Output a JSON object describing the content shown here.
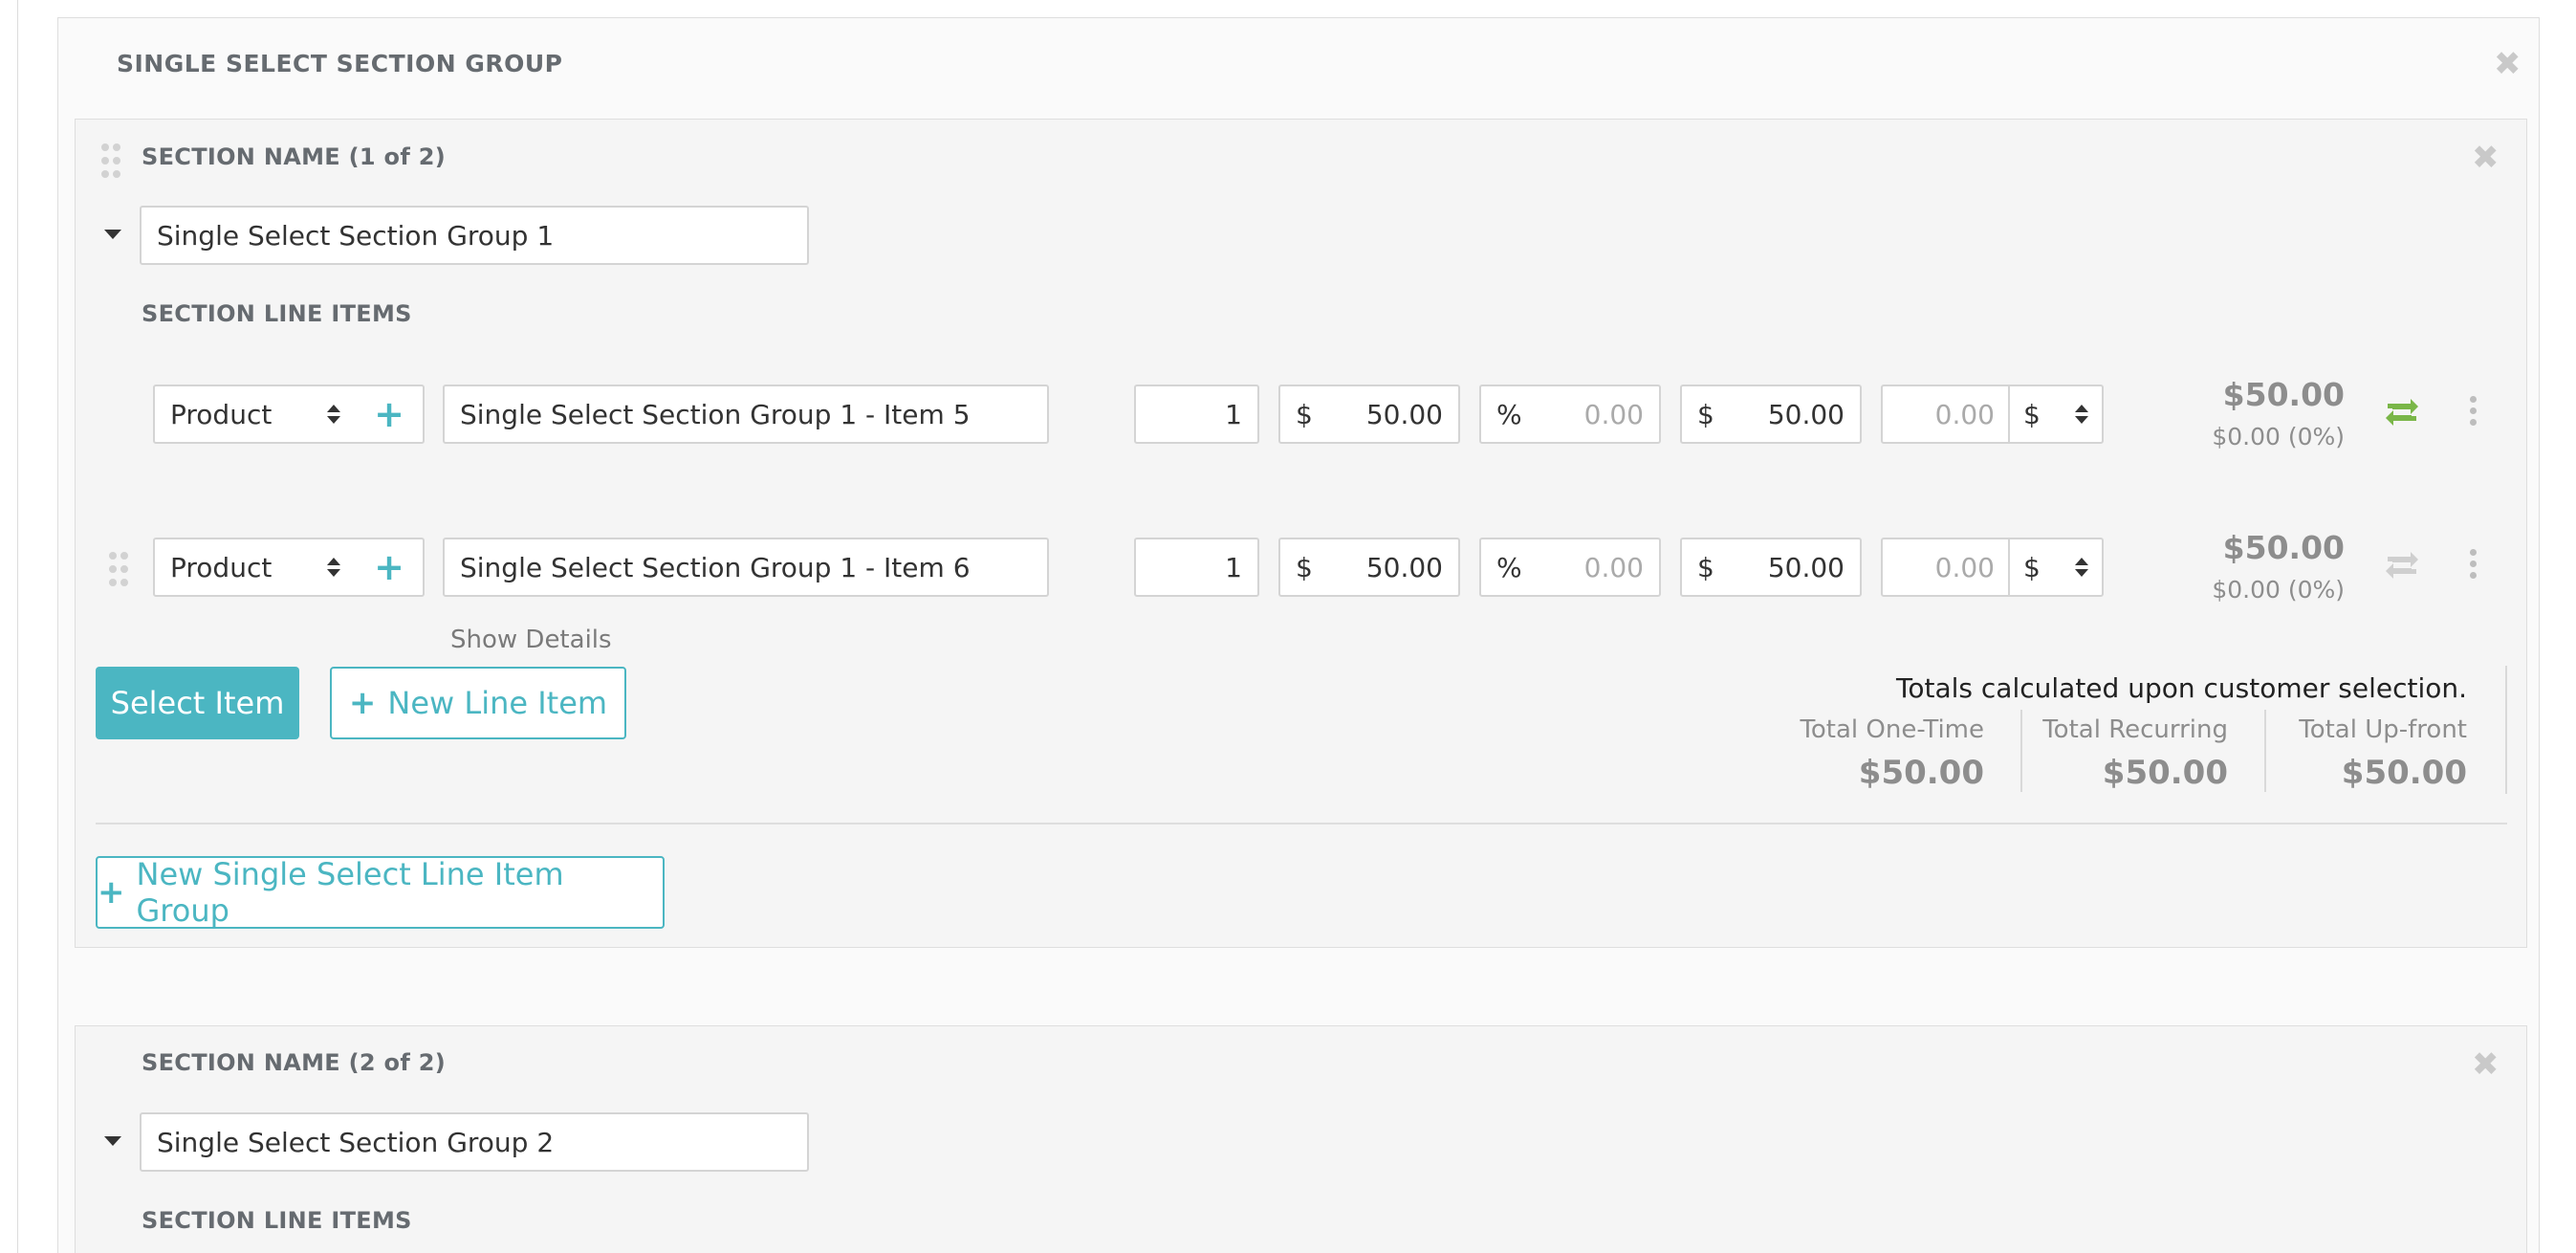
{
  "group": {
    "title": "SINGLE SELECT SECTION GROUP"
  },
  "sections": [
    {
      "title": "SECTION NAME (1 of 2)",
      "name_value": "Single Select Section Group 1",
      "line_items_title": "SECTION LINE ITEMS",
      "line_items": [
        {
          "type": "Product",
          "description": "Single Select Section Group 1 - Item 5",
          "quantity": "1",
          "currency": "$",
          "price": "50.00",
          "discount_unit": "%",
          "discount": "0.00",
          "total_currency": "$",
          "total": "50.00",
          "extra": "0.00",
          "extra_unit": "$",
          "price_main": "$50.00",
          "price_sub": "$0.00 (0%)",
          "recurring_active": true
        },
        {
          "type": "Product",
          "description": "Single Select Section Group 1 - Item 6",
          "quantity": "1",
          "currency": "$",
          "price": "50.00",
          "discount_unit": "%",
          "discount": "0.00",
          "total_currency": "$",
          "total": "50.00",
          "extra": "0.00",
          "extra_unit": "$",
          "price_main": "$50.00",
          "price_sub": "$0.00 (0%)",
          "recurring_active": false
        }
      ],
      "show_details": "Show Details",
      "select_item": "Select Item",
      "new_line_item": "New Line Item",
      "totals_note": "Totals calculated upon customer selection.",
      "totals": [
        {
          "label": "Total One-Time",
          "value": "$50.00"
        },
        {
          "label": "Total Recurring",
          "value": "$50.00"
        },
        {
          "label": "Total Up-front",
          "value": "$50.00"
        }
      ],
      "new_group_button": "New Single Select Line Item Group"
    },
    {
      "title": "SECTION NAME (2 of 2)",
      "name_value": "Single Select Section Group 2",
      "line_items_title": "SECTION LINE ITEMS"
    }
  ],
  "colors": {
    "accent": "#4bb6c2",
    "recurring_active": "#7ab648",
    "recurring_inactive": "#cfcfcf"
  },
  "icons": [
    "close-icon",
    "drag-handle-icon",
    "caret-down-icon",
    "plus-icon",
    "select-arrows-icon",
    "recurring-icon",
    "kebab-menu-icon"
  ]
}
